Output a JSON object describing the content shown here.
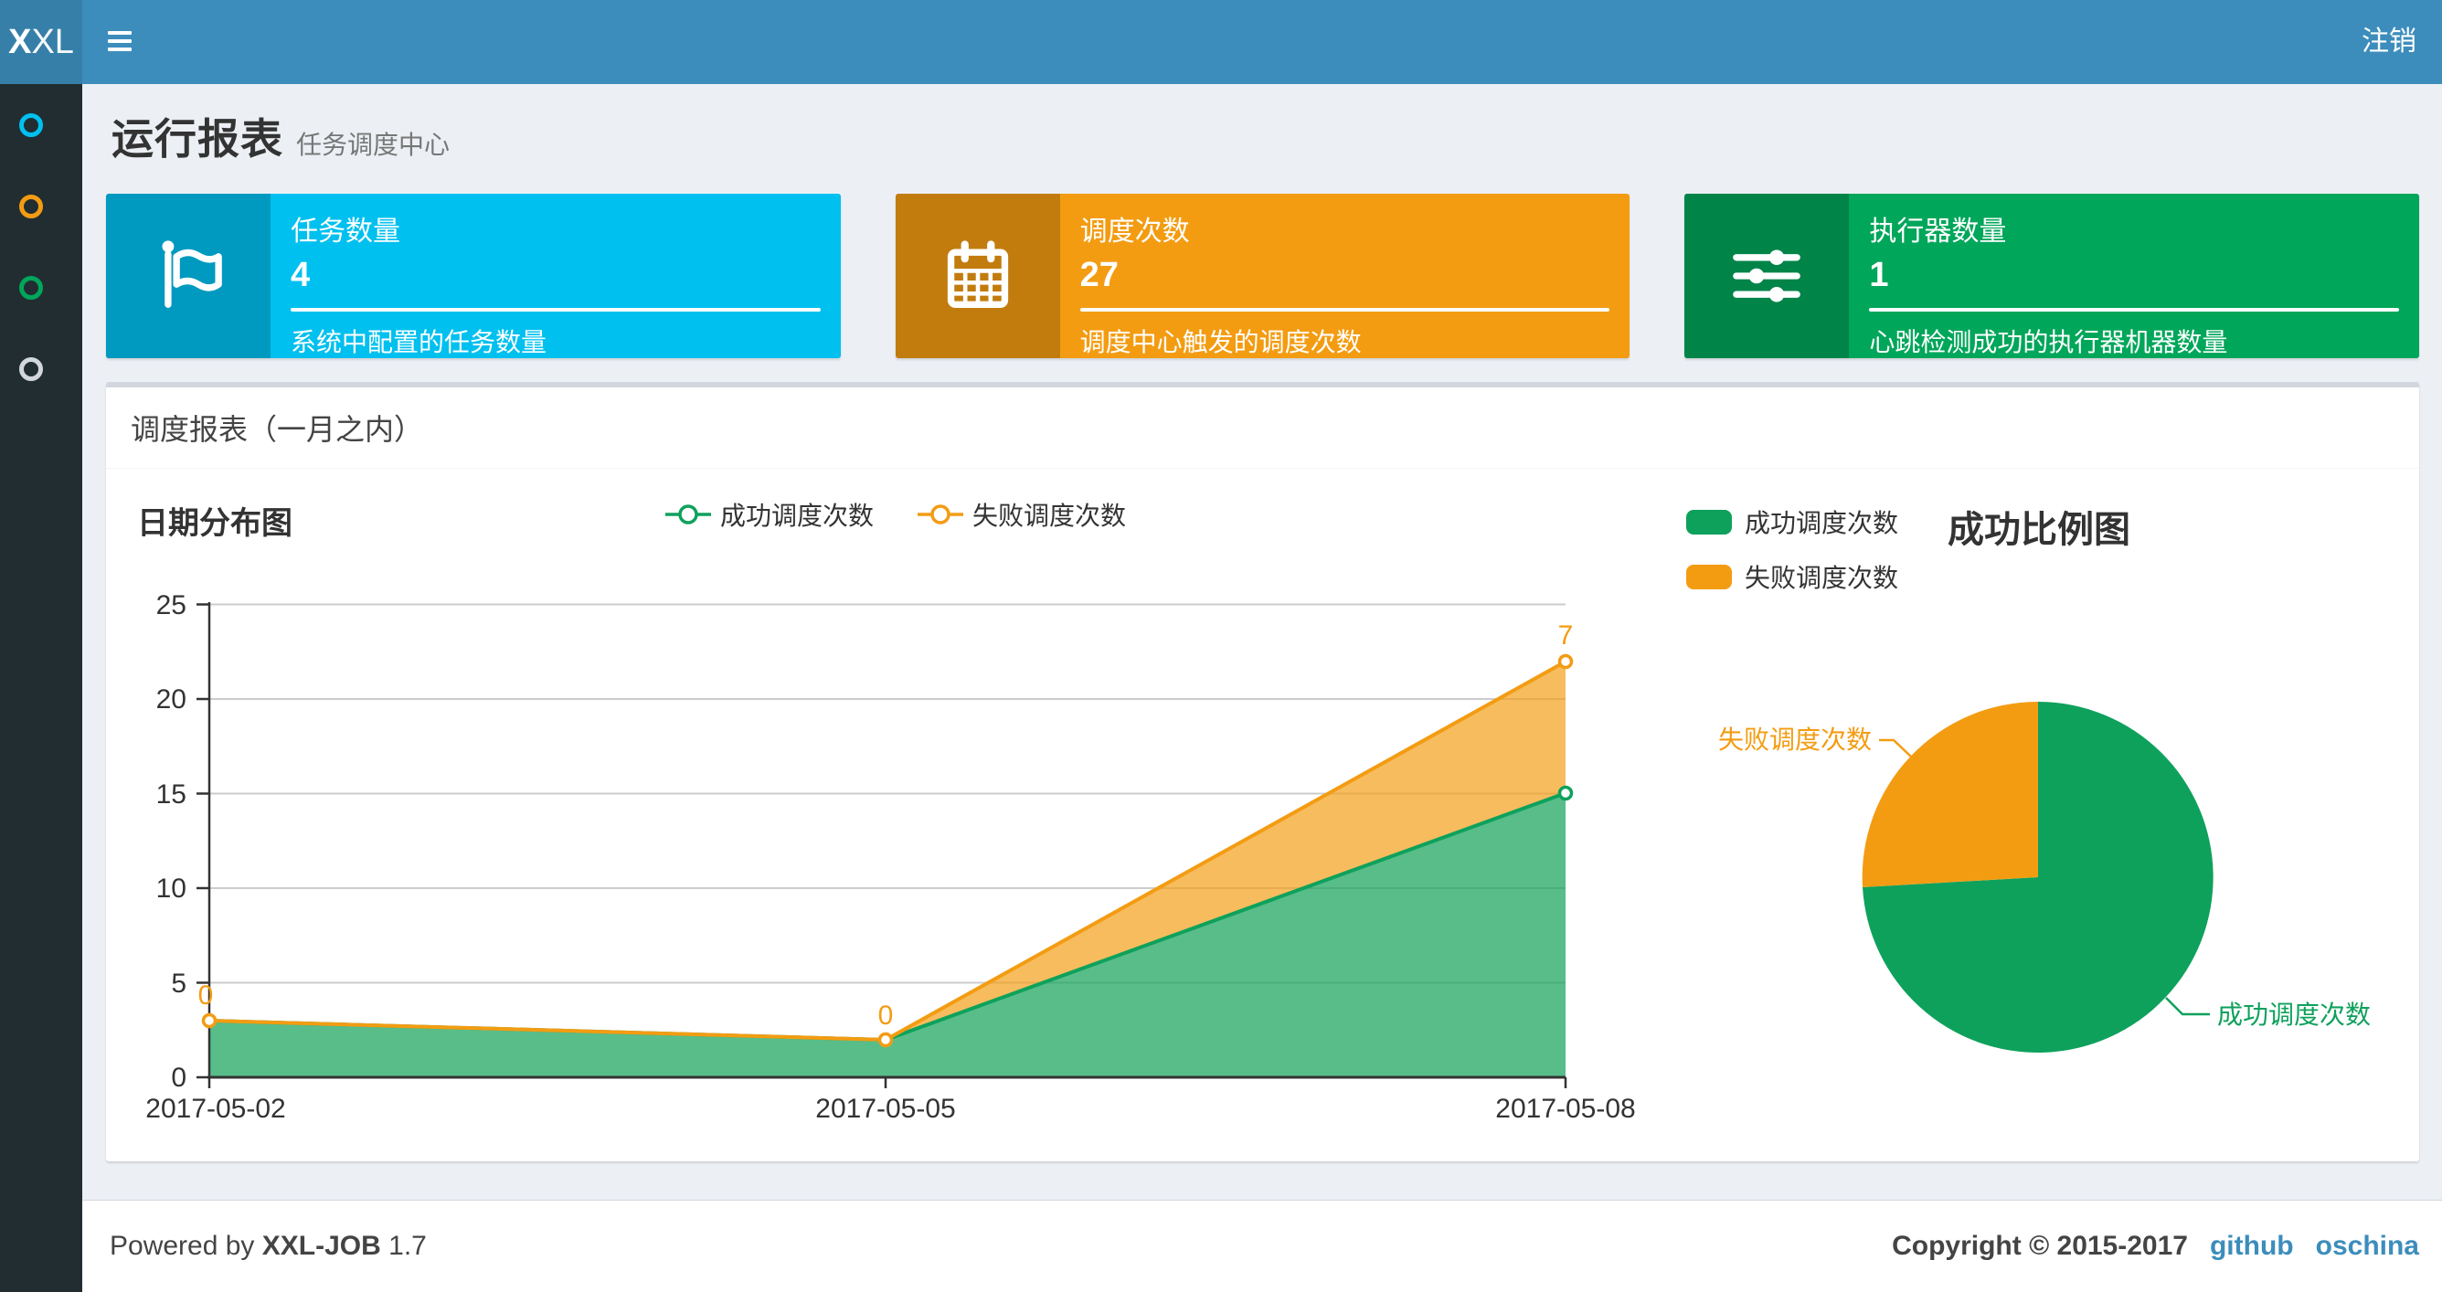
{
  "colors": {
    "navbar": "#3c8dbc",
    "navbar_logo_bg": "#367fa9",
    "sidebar_bg": "#222d32",
    "content_bg": "#ecf0f5",
    "box_aqua": "#00c0ef",
    "box_yellow": "#f39c12",
    "box_green": "#00a65a",
    "chart_success": "#0ea15c",
    "chart_fail": "#f39c12",
    "link_blue": "#3c8dbc"
  },
  "navbar": {
    "logo_bold": "X",
    "logo_rest": "XL",
    "logout_label": "注销"
  },
  "sidebar": {
    "items": [
      {
        "icon": "circle-outline-icon",
        "color": "#00c0ef"
      },
      {
        "icon": "circle-outline-icon",
        "color": "#f39c12"
      },
      {
        "icon": "circle-outline-icon",
        "color": "#00a65a"
      },
      {
        "icon": "circle-outline-icon",
        "color": "#d2d6de"
      }
    ]
  },
  "page_header": {
    "title": "运行报表",
    "subtitle": "任务调度中心"
  },
  "info_boxes": [
    {
      "label": "任务数量",
      "value": "4",
      "description": "系统中配置的任务数量",
      "color": "#00c0ef",
      "icon": "flag-icon"
    },
    {
      "label": "调度次数",
      "value": "27",
      "description": "调度中心触发的调度次数",
      "color": "#f39c12",
      "icon": "calendar-icon"
    },
    {
      "label": "执行器数量",
      "value": "1",
      "description": "心跳检测成功的执行器机器数量",
      "color": "#00a65a",
      "icon": "sliders-icon"
    }
  ],
  "panel": {
    "title": "调度报表（一月之内）"
  },
  "chart_data": [
    {
      "type": "area",
      "title": "日期分布图",
      "x": [
        "2017-05-02",
        "2017-05-05",
        "2017-05-08"
      ],
      "series": [
        {
          "name": "成功调度次数",
          "color": "#0ea15c",
          "values": [
            3,
            2,
            15
          ]
        },
        {
          "name": "失败调度次数",
          "color": "#f39c12",
          "values": [
            0,
            0,
            7
          ]
        }
      ],
      "stacked": true,
      "point_labels": [
        "0",
        "0",
        "7"
      ],
      "ylim": [
        0,
        25
      ],
      "y_ticks": [
        "25",
        "20",
        "15",
        "10",
        "5",
        "0"
      ],
      "grid": true,
      "legend_position": "top-center"
    },
    {
      "type": "pie",
      "title": "成功比例图",
      "slices": [
        {
          "name": "成功调度次数",
          "value": 20,
          "color": "#0ea15c"
        },
        {
          "name": "失败调度次数",
          "value": 7,
          "color": "#f39c12"
        }
      ],
      "legend_position": "top-left"
    }
  ],
  "footer": {
    "powered_prefix": "Powered by",
    "product": "XXL-JOB",
    "version": "1.7",
    "copyright": "Copyright © 2015-2017",
    "links": [
      {
        "label": "github"
      },
      {
        "label": "oschina"
      }
    ]
  }
}
